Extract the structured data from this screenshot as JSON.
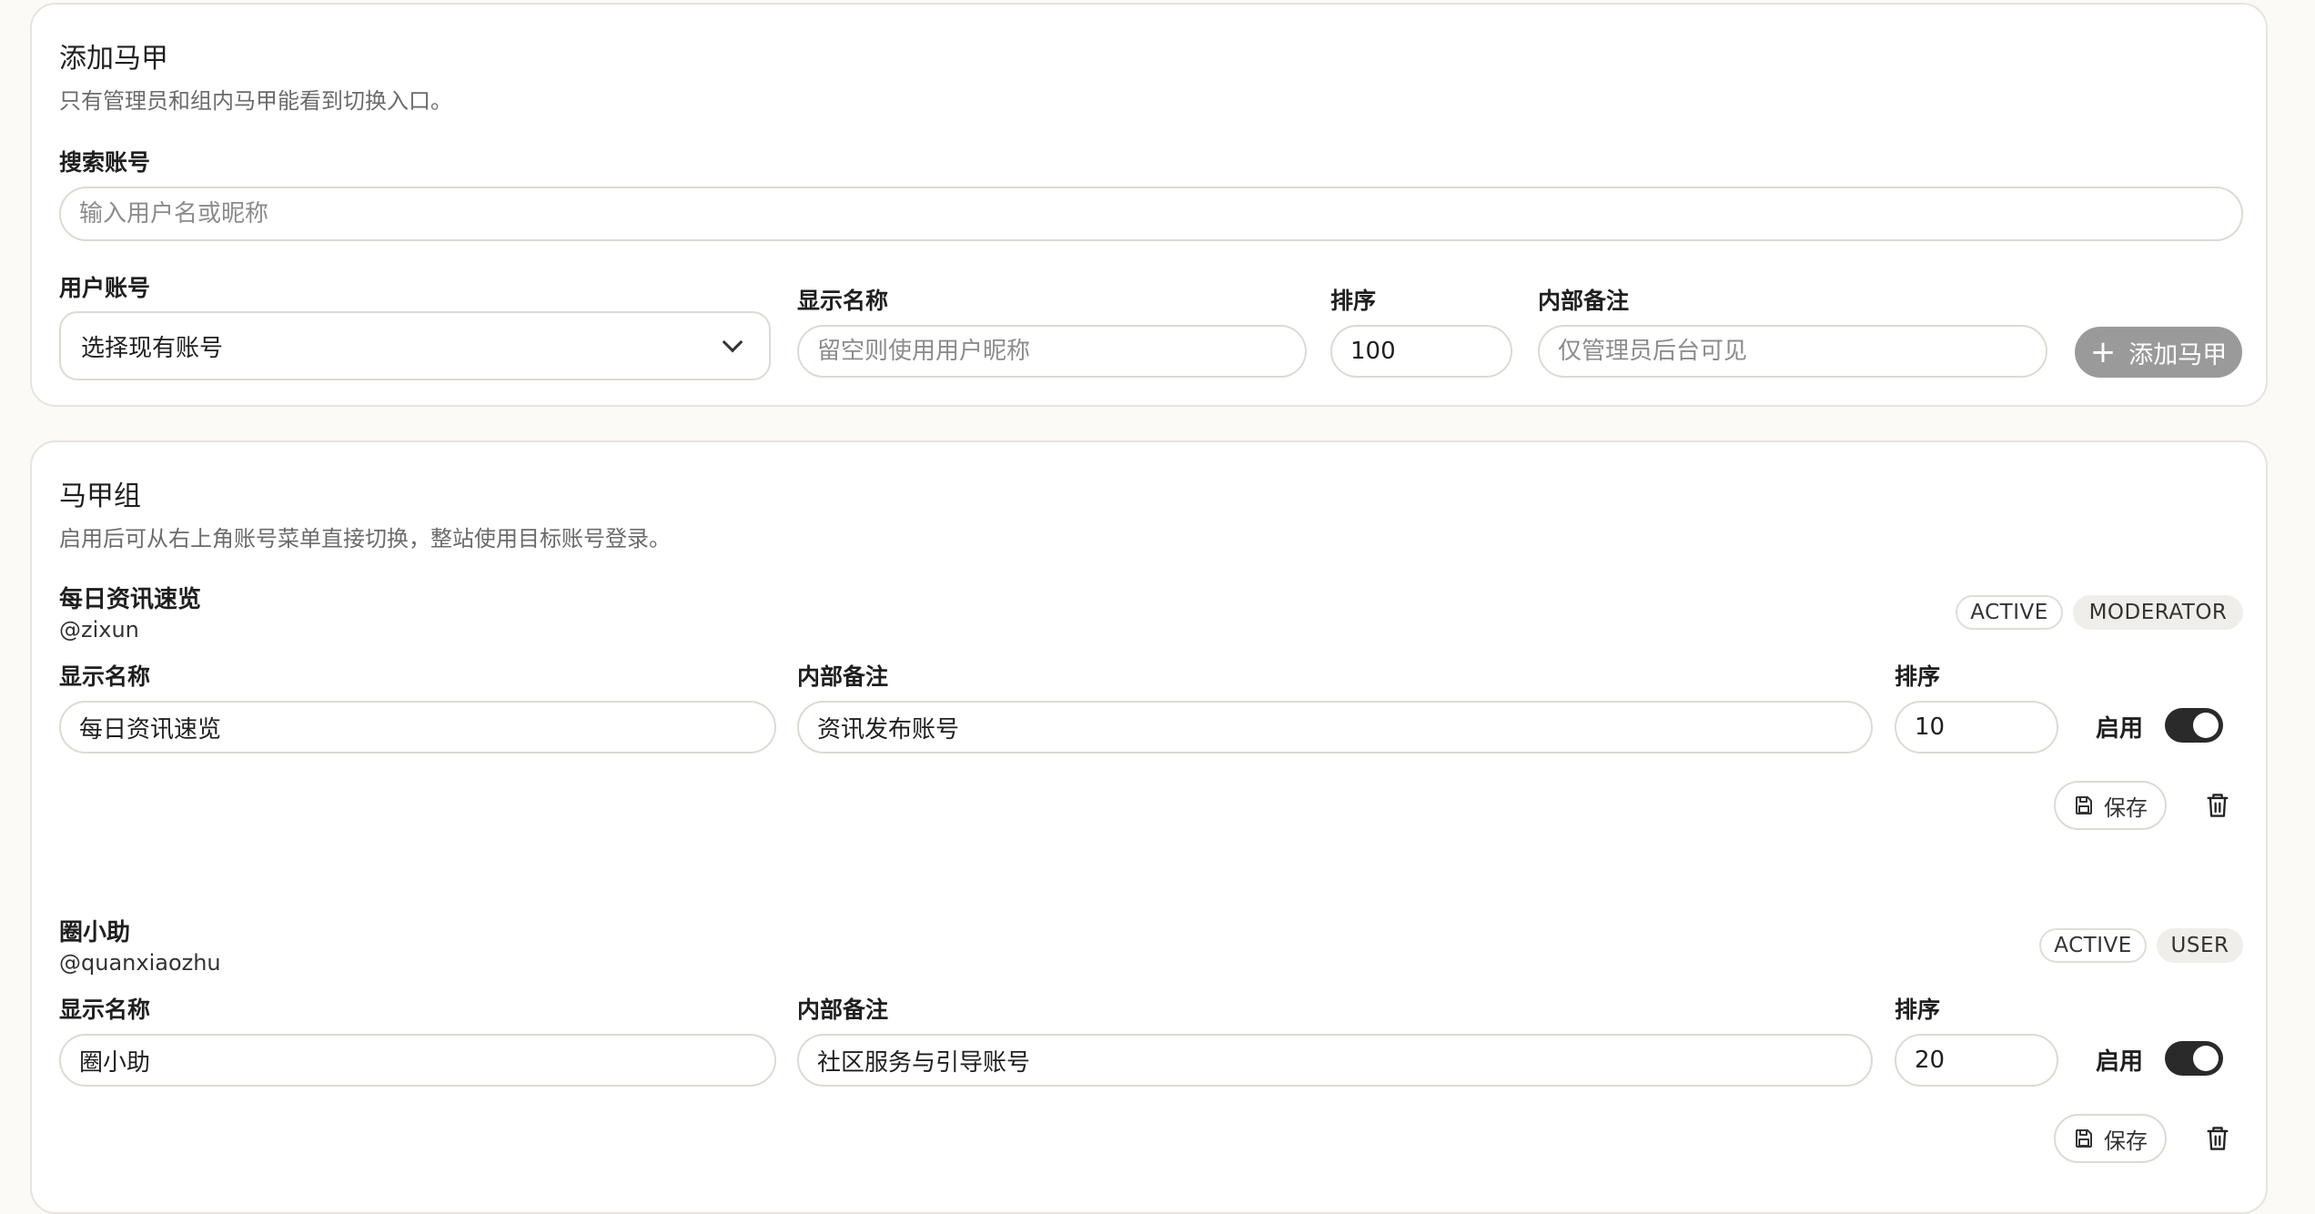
{
  "add_section": {
    "title": "添加马甲",
    "description": "只有管理员和组内马甲能看到切换入口。",
    "search_label": "搜索账号",
    "search_placeholder": "输入用户名或昵称",
    "user_account_label": "用户账号",
    "user_account_value": "选择现有账号",
    "display_name_label": "显示名称",
    "display_name_placeholder": "留空则使用用户昵称",
    "order_label": "排序",
    "order_value": "100",
    "note_label": "内部备注",
    "note_placeholder": "仅管理员后台可见",
    "add_button_label": "添加马甲",
    "add_button_color": "#9a9a9a"
  },
  "group_section": {
    "title": "马甲组",
    "description": "启用后可从右上角账号菜单直接切换，整站使用目标账号登录。",
    "items": [
      {
        "name": "每日资讯速览",
        "handle": "@zixun",
        "status_badge": "ACTIVE",
        "role_badge": "MODERATOR",
        "display_name_label": "显示名称",
        "display_name_value": "每日资讯速览",
        "note_label": "内部备注",
        "note_value": "资讯发布账号",
        "order_label": "排序",
        "order_value": "10",
        "enable_label": "启用",
        "enabled": true,
        "save_label": "保存"
      },
      {
        "name": "圈小助",
        "handle": "@quanxiaozhu",
        "status_badge": "ACTIVE",
        "role_badge": "USER",
        "display_name_label": "显示名称",
        "display_name_value": "圈小助",
        "note_label": "内部备注",
        "note_value": "社区服务与引导账号",
        "order_label": "排序",
        "order_value": "20",
        "enable_label": "启用",
        "enabled": true,
        "save_label": "保存"
      }
    ]
  },
  "icons": {
    "dropdown": "chevron-down-icon",
    "add": "plus-icon",
    "save": "save-icon",
    "delete": "trash-icon"
  }
}
